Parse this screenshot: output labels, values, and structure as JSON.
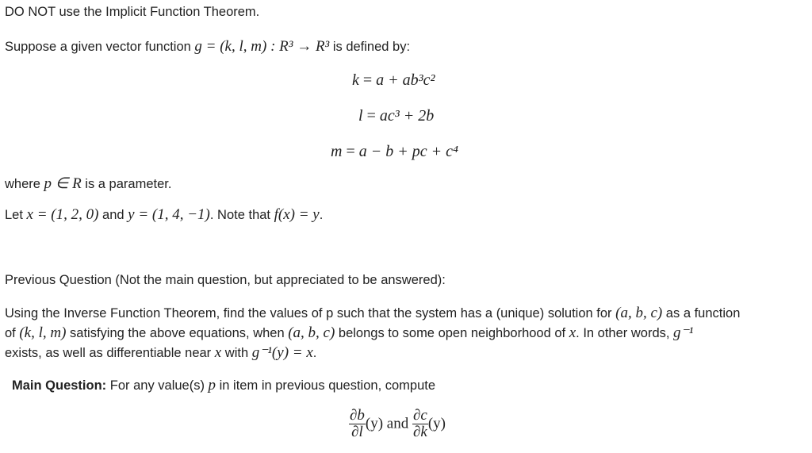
{
  "warning": "DO NOT use the Implicit Function Theorem.",
  "intro": {
    "prefix": "Suppose a given vector function ",
    "math": "g = (k, l, m) : R³ → R³",
    "suffix": " is defined by:"
  },
  "equations": [
    {
      "lhs": "k",
      "rhs": "a + ab³c²"
    },
    {
      "lhs": "l",
      "rhs": "ac³ + 2b"
    },
    {
      "lhs": "m",
      "rhs": "a − b + pc + c⁴"
    }
  ],
  "parameter_line": {
    "prefix": "where ",
    "math": "p ∈ R",
    "suffix": " is a parameter."
  },
  "let_line": {
    "prefix": "Let ",
    "x_math": "x = (1, 2, 0)",
    "mid": " and ",
    "y_math": "y = (1, 4, −1)",
    "mid2": ". Note that ",
    "f_math": "f(x) = y",
    "suffix": "."
  },
  "previous_question": {
    "heading": "Previous Question (Not the main question, but appreciated to be answered):",
    "line1_a": "Using the Inverse Function Theorem, find the values of p such that the system has a (unique) solution for ",
    "line1_math": "(a, b, c)",
    "line1_b": " as a function",
    "line2_a": "of ",
    "line2_math1": "(k, l, m)",
    "line2_b": " satisfying the above equations, when ",
    "line2_math2": "(a, b, c)",
    "line2_c": " belongs to some open neighborhood of ",
    "line2_math3": "x",
    "line2_d": ". In other words, ",
    "line2_math4": "g⁻¹",
    "line3_a": "exists, as well as differentiable near ",
    "line3_math1": "x",
    "line3_b": " with ",
    "line3_math2": "g⁻¹(y) = x",
    "line3_c": "."
  },
  "main_question": {
    "label": "Main Question:",
    "text_a": " For any value(s) ",
    "math_p": "p",
    "text_b": " in item in previous question, compute",
    "frac1_num": "∂b",
    "frac1_den": "∂l",
    "frac1_arg": "(y)",
    "and": " and ",
    "frac2_num": "∂c",
    "frac2_den": "∂k",
    "frac2_arg": "(y)"
  }
}
